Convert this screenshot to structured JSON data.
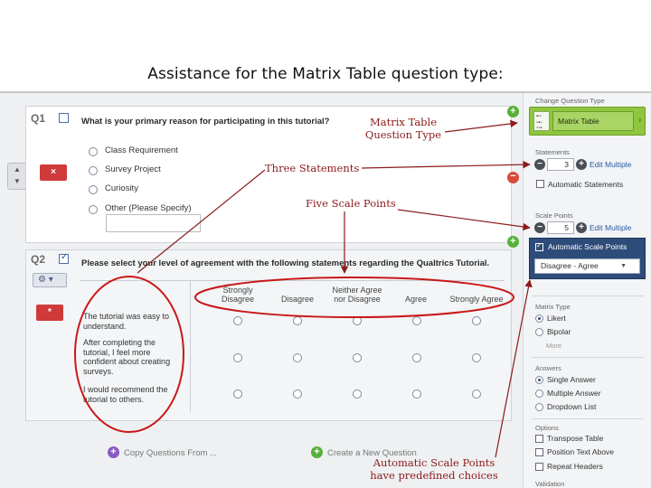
{
  "slide": {
    "title": "Assistance for the Matrix Table question type:"
  },
  "q1": {
    "number": "Q1",
    "text": "What is your primary reason for participating in this tutorial?",
    "delete_label": "×",
    "choices": [
      "Class Requirement",
      "Survey Project",
      "Curiosity",
      "Other (Please Specify)"
    ]
  },
  "q2": {
    "number": "Q2",
    "gear_label": "⚙ ▾",
    "delete_label": "*",
    "text": "Please select your level of agreement with the following statements regarding the Qualtrics Tutorial.",
    "scale_points": [
      [
        "Strongly",
        "Disagree"
      ],
      [
        "",
        "Disagree"
      ],
      [
        "Neither Agree",
        "nor Disagree"
      ],
      [
        "",
        "Agree"
      ],
      [
        "",
        "Strongly Agree"
      ]
    ],
    "statements": [
      [
        "The tutorial was easy to",
        "understand."
      ],
      [
        "After completing the",
        "tutorial, I feel more",
        "confident about creating",
        "surveys."
      ],
      [
        "I would recommend the",
        "tutorial to others."
      ]
    ]
  },
  "footer": {
    "copy_label": "Copy Questions From ...",
    "create_label": "Create a New Question"
  },
  "panel": {
    "change_type_label": "Change Question Type",
    "type_value": "Matrix Table",
    "statements_label": "Statements",
    "statements_count": "3",
    "scale_points_label": "Scale Points",
    "scale_points_count": "5",
    "edit_multiple": "Edit Multiple",
    "automatic_statements": "Automatic Statements",
    "automatic_scale_points": "Automatic Scale Points",
    "scale_preset": "Disagree - Agree",
    "matrix_type_label": "Matrix Type",
    "matrix_types": [
      "Likert",
      "Bipolar"
    ],
    "more_label": "More",
    "answers_label": "Answers",
    "answers": [
      "Single Answer",
      "Multiple Answer",
      "Dropdown List"
    ],
    "options_label": "Options",
    "options": [
      "Transpose Table",
      "Position Text Above",
      "Repeat Headers"
    ],
    "validation_label": "Validation"
  },
  "annotations": {
    "matrix_type": [
      "Matrix Table",
      "Question Type"
    ],
    "statements": "Three Statements",
    "scale_points": "Five Scale Points",
    "auto_scale": [
      "Automatic Scale Points",
      "have predefined choices"
    ]
  },
  "colors": {
    "annotation": "#8b1a1a",
    "type_box": "#8ec63f",
    "scale_box": "#2e4c7a",
    "delete": "#cf3a3a"
  }
}
